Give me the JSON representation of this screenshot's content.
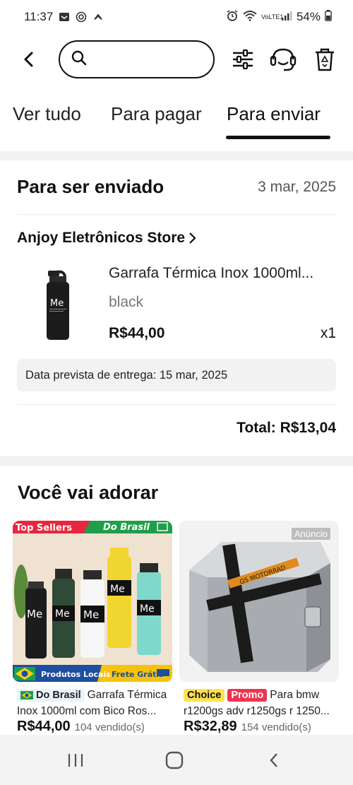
{
  "status_bar": {
    "time": "11:37",
    "battery": "54%",
    "network": "VoLTE1"
  },
  "header": {
    "search_placeholder": "",
    "icons": [
      "back-icon",
      "search-icon",
      "filter-icon",
      "support-icon",
      "recycle-bin-icon"
    ]
  },
  "tabs": [
    {
      "label": "Ver tudo"
    },
    {
      "label": "Para pagar"
    },
    {
      "label": "Para enviar",
      "active": true
    }
  ],
  "order": {
    "title": "Para ser enviado",
    "date": "3 mar, 2025",
    "store": "Anjoy Eletrônicos Store",
    "product_title": "Garrafa Térmica Inox 1000ml...",
    "variant": "black",
    "price": "R$44,00",
    "quantity": "x1",
    "delivery": "Data prevista de entrega: 15 mar, 2025",
    "total": "Total: R$13,04"
  },
  "recommendations": {
    "title": "Você vai adorar",
    "items": [
      {
        "banner_top_left": "Top Sellers",
        "banner_top_right": "Do Brasil",
        "banner_bottom_left": "Produtos Locais",
        "banner_bottom_right": "Frete Grátis",
        "badge": "Do Brasil",
        "title_line1": "Garrafa Térmica",
        "title_line2": "Inox 1000ml  com Bico Ros...",
        "price": "R$44,00",
        "sold": "104  vendido(s)"
      },
      {
        "ad_label": "Anúncio",
        "badge_choice": "Choice",
        "badge_promo": "Promo",
        "title_line1": "Para bmw",
        "title_line2": "r1200gs adv r1250gs r 1250...",
        "price": "R$32,89",
        "sold": "154  vendido(s)"
      }
    ]
  },
  "colors": {
    "accent": "#111111",
    "promo_red": "#f0344e",
    "choice_yellow": "#ffe24d",
    "top_sellers_red": "#e8263d",
    "brasil_green": "#1f9e4a"
  }
}
